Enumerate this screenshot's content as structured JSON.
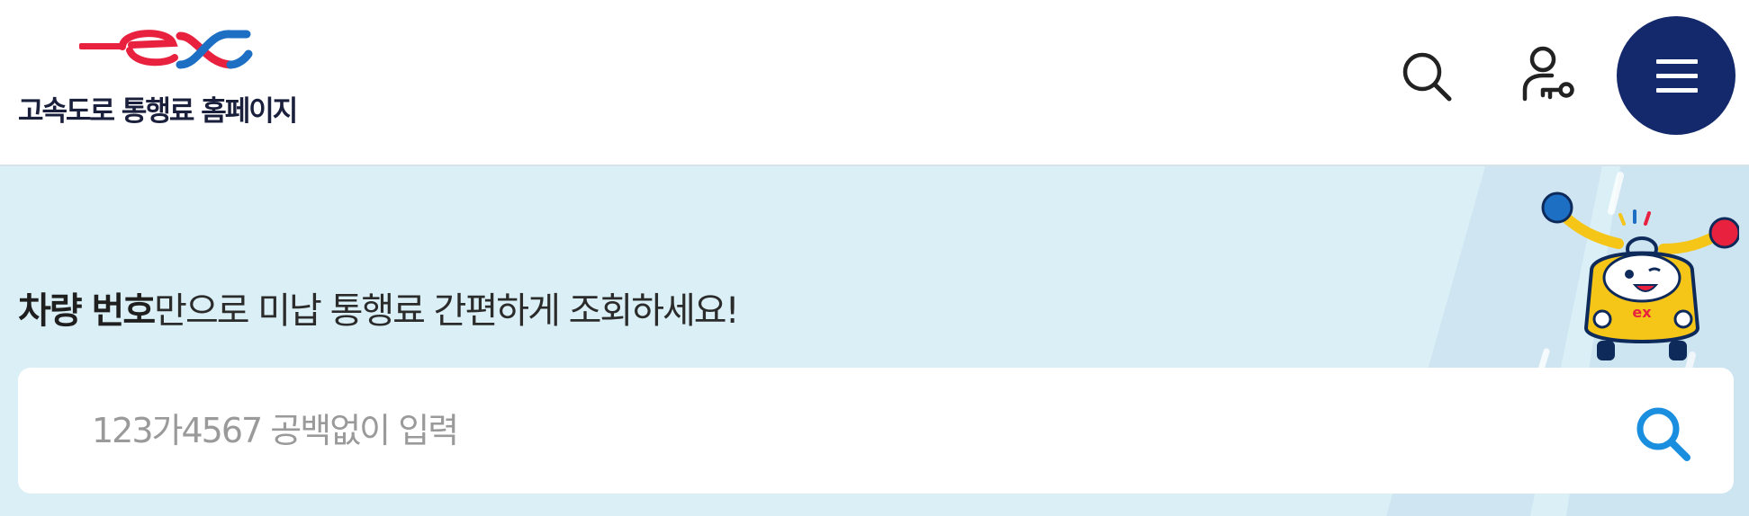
{
  "header": {
    "logo_text": "고속도로 통행료 홈페이지",
    "search_icon": "search-icon",
    "user_icon": "user-key-icon",
    "menu_icon": "hamburger-menu-icon"
  },
  "hero": {
    "headline_bold": "차량 번호",
    "headline_rest": "만으로 미납 통행료 간편하게 조회하세요!",
    "search": {
      "placeholder": "123가4567 공백없이 입력",
      "value": "",
      "submit_icon": "search-icon"
    },
    "mascot_icon": "ex-car-mascot-icon"
  },
  "colors": {
    "brand_red": "#e8213f",
    "brand_blue": "#1d6fc4",
    "menu_navy": "#13296b",
    "hero_bg": "#dbf0f6",
    "accent_search": "#1a8fe0"
  }
}
